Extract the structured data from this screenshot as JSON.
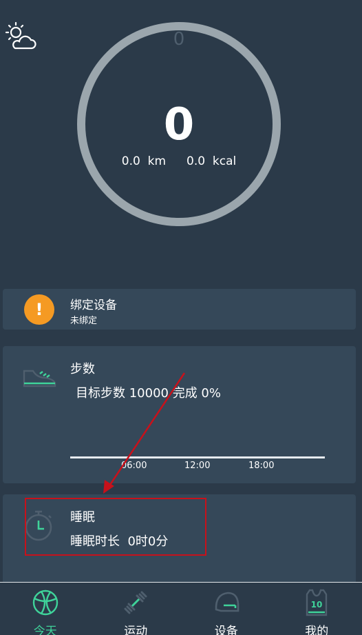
{
  "weather": {
    "icon": "partly-cloudy-icon"
  },
  "ring": {
    "top_value": "0",
    "steps": "0",
    "distance": "0.0  km",
    "calories": "0.0  kcal",
    "progress": 0,
    "ring_color": "#9ba6ad"
  },
  "bind_card": {
    "icon": "warning-icon",
    "title": "绑定设备",
    "subtitle": "未绑定",
    "icon_color": "#f59a23"
  },
  "steps_card": {
    "icon": "sneaker-icon",
    "title": "步数",
    "goal_text": "目标步数 10000 完成 0%",
    "ticks": [
      "06:00",
      "12:00",
      "18:00"
    ]
  },
  "sleep_card": {
    "icon": "stopwatch-icon",
    "title": "睡眠",
    "duration_text": "睡眠时长  0时0分"
  },
  "tabs": [
    {
      "label": "今天",
      "icon": "basketball-icon",
      "active": true
    },
    {
      "label": "运动",
      "icon": "dumbbell-icon",
      "active": false
    },
    {
      "label": "设备",
      "icon": "helmet-icon",
      "active": false
    },
    {
      "label": "我的",
      "icon": "jersey-icon",
      "active": false,
      "badge": "10"
    }
  ],
  "colors": {
    "background": "#2b3a49",
    "card": "#354859",
    "accent": "#3fd39a",
    "annotation": "#c8111b"
  }
}
